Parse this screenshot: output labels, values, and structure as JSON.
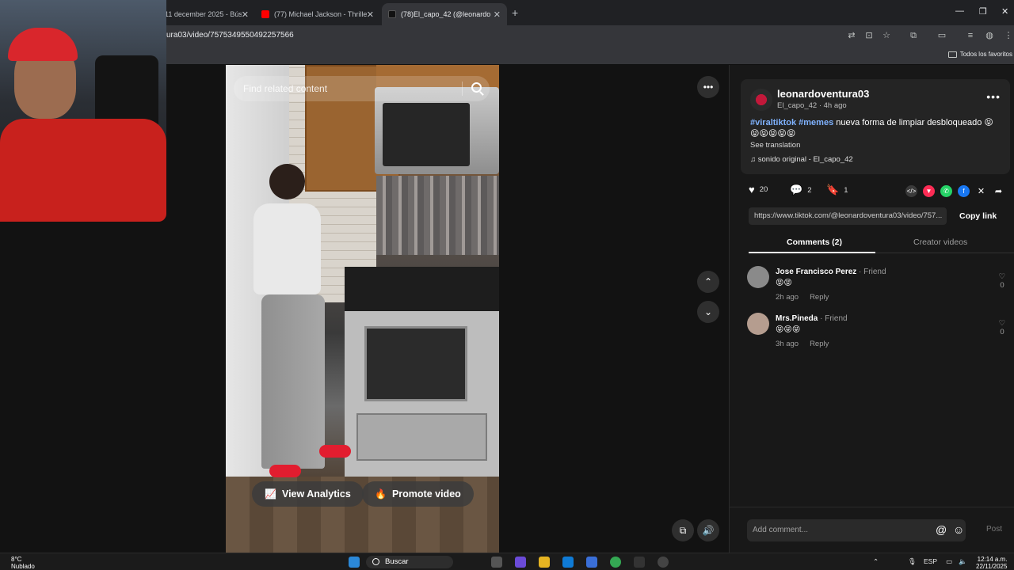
{
  "browser": {
    "tabs": [
      {
        "title": "11 december 2025 - Bús",
        "close": "✕"
      },
      {
        "title": "(77) Michael Jackson - Thriller (",
        "close": "✕"
      },
      {
        "title": "(78)El_capo_42 (@leonardo",
        "close": "✕"
      }
    ],
    "new_tab": "+",
    "url": "ura03/video/7575349550492257566",
    "bookmarks_all": "Todos los favoritos",
    "window_controls": [
      "—",
      "❐",
      "✕"
    ]
  },
  "video": {
    "search_placeholder": "Find related content",
    "view_analytics": "View Analytics",
    "promote_video": "Promote video",
    "more": "•••",
    "up": "⌃",
    "down": "⌄"
  },
  "post": {
    "username": "leonardoventura03",
    "meta": "El_capo_42 · 4h ago",
    "hashtag1": "#viraltiktok",
    "hashtag2": "#memes",
    "description": " nueva forma de limpiar desbloqueado 😝",
    "emoji_line": "😝😝😝😝😝",
    "see_translation": "See translation",
    "sound": "sonido original - El_capo_42",
    "likes": "20",
    "comments": "2",
    "saves": "1",
    "link": "https://www.tiktok.com/@leonardoventura03/video/757...",
    "copy_link": "Copy link"
  },
  "panel_tabs": {
    "comments": "Comments (2)",
    "creator_videos": "Creator videos"
  },
  "comments": [
    {
      "name": "Jose Francisco Perez",
      "friend": " · Friend",
      "text": "😝😝",
      "time": "2h ago",
      "reply": "Reply",
      "likes": "0"
    },
    {
      "name": "Mrs.Pineda",
      "friend": " · Friend",
      "text": "😝😝😝",
      "time": "3h ago",
      "reply": "Reply",
      "likes": "0"
    }
  ],
  "comment_bar": {
    "placeholder": "Add comment...",
    "post": "Post"
  },
  "taskbar": {
    "temp": "8°C",
    "weather": "Nublado",
    "search": "Buscar",
    "lang": "ESP",
    "time": "12:14 a.m.",
    "date": "22/11/2025"
  },
  "colors": {
    "accent_pink": "#fe2c55",
    "hashtag_blue": "#7fb2ff",
    "panel_bg": "#181818"
  }
}
